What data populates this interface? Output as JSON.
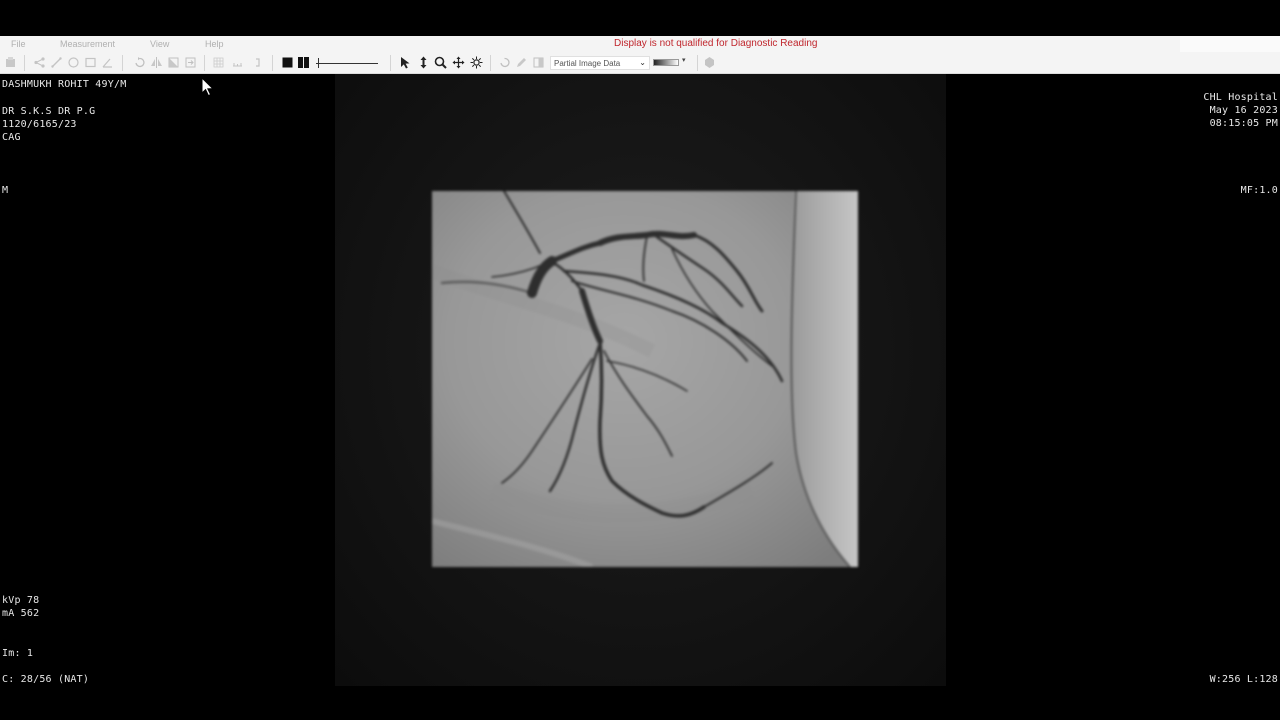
{
  "menu": {
    "items": [
      "File",
      "Measurement",
      "View",
      "Help"
    ],
    "warning": "Display is not qualified for Diagnostic Reading"
  },
  "toolbar": {
    "data_mode_select": "Partial Image Data",
    "icons": [
      "print-icon",
      "share-icon",
      "ruler-icon",
      "ellipse-icon",
      "rectangle-icon",
      "angle-icon",
      "rotate-icon",
      "flip-icon",
      "invert-icon",
      "reset-icon",
      "grid-icon",
      "layout-icon",
      "series-icon",
      "stop-icon",
      "play-pause-icon",
      "pointer-icon",
      "scroll-icon",
      "zoom-icon",
      "pan-icon",
      "window-level-icon",
      "undo-icon",
      "pencil-icon",
      "contrast-icon",
      "tools-icon"
    ],
    "colors": {
      "warning": "#c0262d",
      "bar": "#f4f4f4"
    }
  },
  "overlay": {
    "patient": "DASHMUKH ROHIT 49Y/M",
    "doctors": "DR S.K.S DR P.G",
    "study_id": "1120/6165/23",
    "procedure": "CAG",
    "orientation": "M",
    "kvp": "kVp 78",
    "ma": "mA 562",
    "image_number": "Im: 1",
    "frame": "C: 28/56 (NAT)",
    "hospital": "CHL Hospital",
    "date": "May 16 2023",
    "time": "08:15:05 PM",
    "magnification": "MF:1.0",
    "window_level": "W:256 L:128"
  }
}
